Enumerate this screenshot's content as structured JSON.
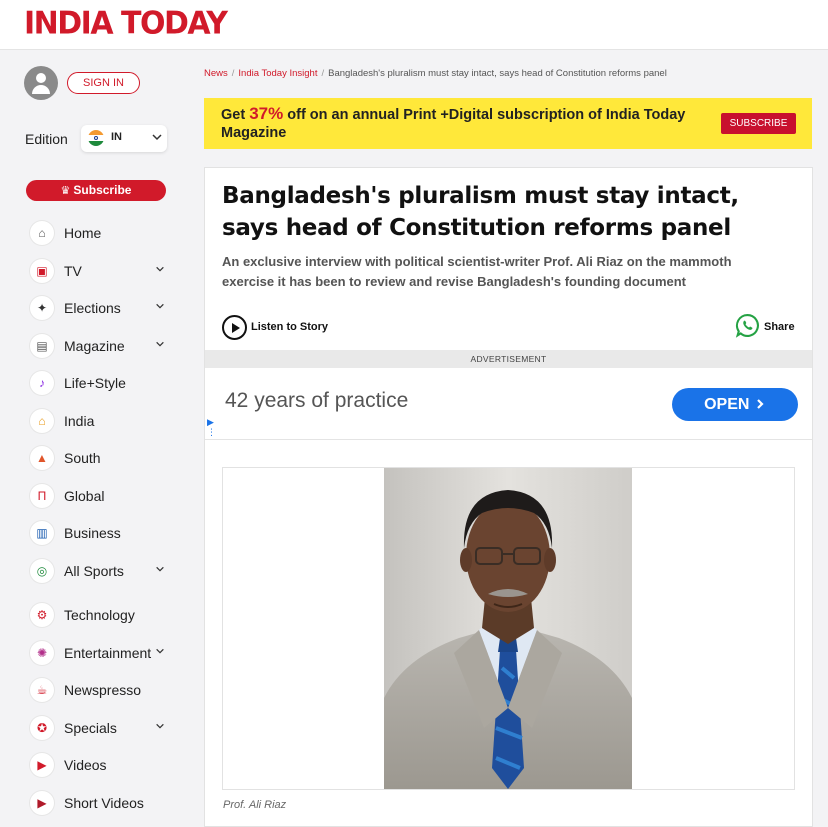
{
  "brand": {
    "logo": "INDIA TODAY"
  },
  "sidebar": {
    "signin_label": "SIGN IN",
    "edition_label": "Edition",
    "edition_code": "IN",
    "subscribe_label": "Subscribe",
    "items": [
      {
        "label": "Home",
        "icon": "home-icon",
        "expandable": false
      },
      {
        "label": "TV",
        "icon": "live-tv-icon",
        "expandable": true
      },
      {
        "label": "Elections",
        "icon": "elections-icon",
        "expandable": true
      },
      {
        "label": "Magazine",
        "icon": "magazine-icon",
        "expandable": true
      },
      {
        "label": "Life+Style",
        "icon": "cocktail-icon",
        "expandable": false
      },
      {
        "label": "India",
        "icon": "india-monument-icon",
        "expandable": false
      },
      {
        "label": "South",
        "icon": "temple-icon",
        "expandable": false
      },
      {
        "label": "Global",
        "icon": "global-gate-icon",
        "expandable": false
      },
      {
        "label": "Business",
        "icon": "business-chart-icon",
        "expandable": false
      },
      {
        "label": "All Sports",
        "icon": "sports-icon",
        "expandable": true
      },
      {
        "label": "Technology",
        "icon": "technology-icon",
        "expandable": false
      },
      {
        "label": "Entertainment",
        "icon": "entertainment-icon",
        "expandable": true
      },
      {
        "label": "Newspresso",
        "icon": "coffee-cup-icon",
        "expandable": false
      },
      {
        "label": "Specials",
        "icon": "specials-badge-icon",
        "expandable": true
      },
      {
        "label": "Videos",
        "icon": "video-camera-icon",
        "expandable": false
      },
      {
        "label": "Short Videos",
        "icon": "short-video-icon",
        "expandable": false
      }
    ]
  },
  "breadcrumb": {
    "items": [
      "News",
      "India Today Insight"
    ],
    "current": "Bangladesh's pluralism must stay intact, says head of Constitution reforms panel"
  },
  "promo": {
    "text_before": "Get ",
    "percent": "37%",
    "text_after": " off on an annual Print +Digital subscription of India Today Magazine",
    "button_label": "SUBSCRIBE"
  },
  "article": {
    "headline": "Bangladesh's pluralism must stay intact, says head of Constitution reforms panel",
    "summary": "An exclusive interview with political scientist-writer Prof. Ali Riaz on the mammoth exercise it has been to review and revise Bangladesh's founding document",
    "listen_label": "Listen to Story",
    "share_label": "Share",
    "image_caption": "Prof. Ali Riaz"
  },
  "ad": {
    "label": "ADVERTISEMENT",
    "text": "42 years of practice",
    "button_label": "OPEN"
  },
  "colors": {
    "brand_red": "#d11a2a",
    "promo_yellow": "#ffe83a",
    "ad_blue": "#1a73e8",
    "sidebar_bg": "#f3f3f5"
  }
}
